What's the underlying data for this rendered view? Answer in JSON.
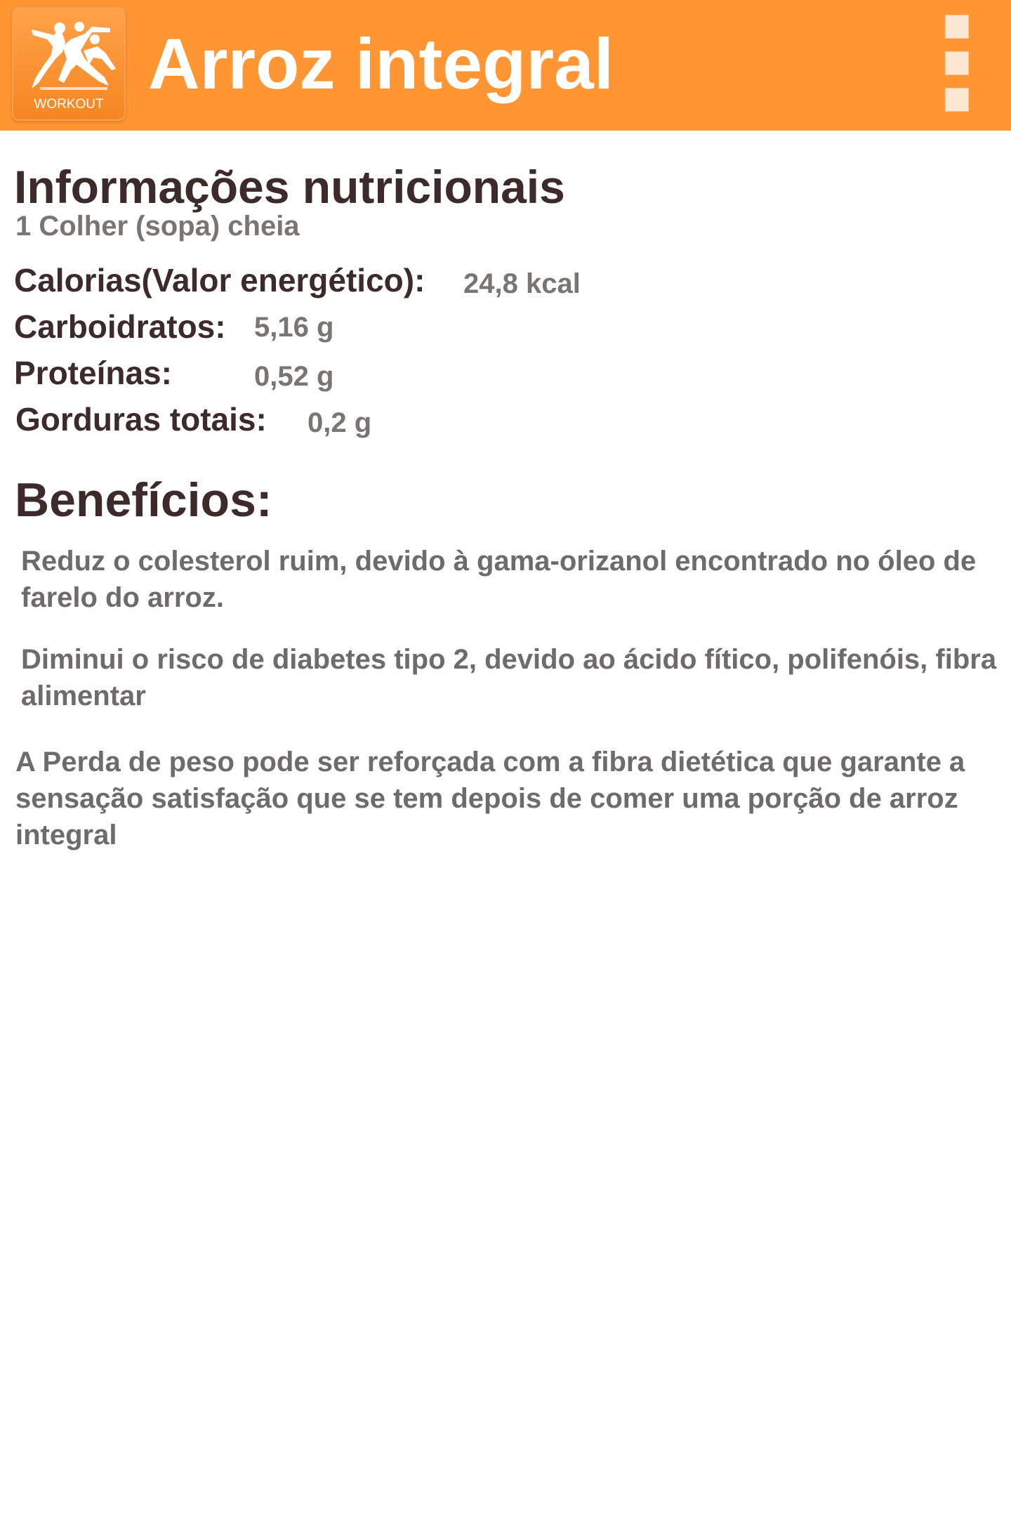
{
  "app_bar": {
    "logo_caption": "WORKOUT",
    "logo_icon": "workout-figures-icon",
    "title": "Arroz integral",
    "menu_icon": "overflow-menu-icon"
  },
  "nutrition": {
    "title": "Informações nutricionais",
    "serving": "1 Colher (sopa) cheia",
    "rows": [
      {
        "label": "Calorias(Valor energético):",
        "value": "24,8 kcal"
      },
      {
        "label": "Carboidratos:",
        "value": "5,16 g"
      },
      {
        "label": "Proteínas:",
        "value": "0,52 g"
      },
      {
        "label": "Gorduras totais:",
        "value": "0,2 g"
      }
    ]
  },
  "benefits": {
    "title": "Benefícios:",
    "items": [
      "Reduz o colesterol ruim, devido à gama-orizanol encontrado no óleo de farelo do arroz.",
      "Diminui o risco de diabetes tipo 2, devido ao ácido fítico, polifenóis, fibra alimentar",
      "A Perda de peso pode ser reforçada com a fibra dietética que garante a sensação satisfação que se tem depois de comer uma porção de arroz integral"
    ]
  },
  "colors": {
    "app_bar": "#ff9633",
    "heading": "#3d2a2b",
    "value_text": "#7a7474",
    "body_text": "#6f6a6b"
  }
}
